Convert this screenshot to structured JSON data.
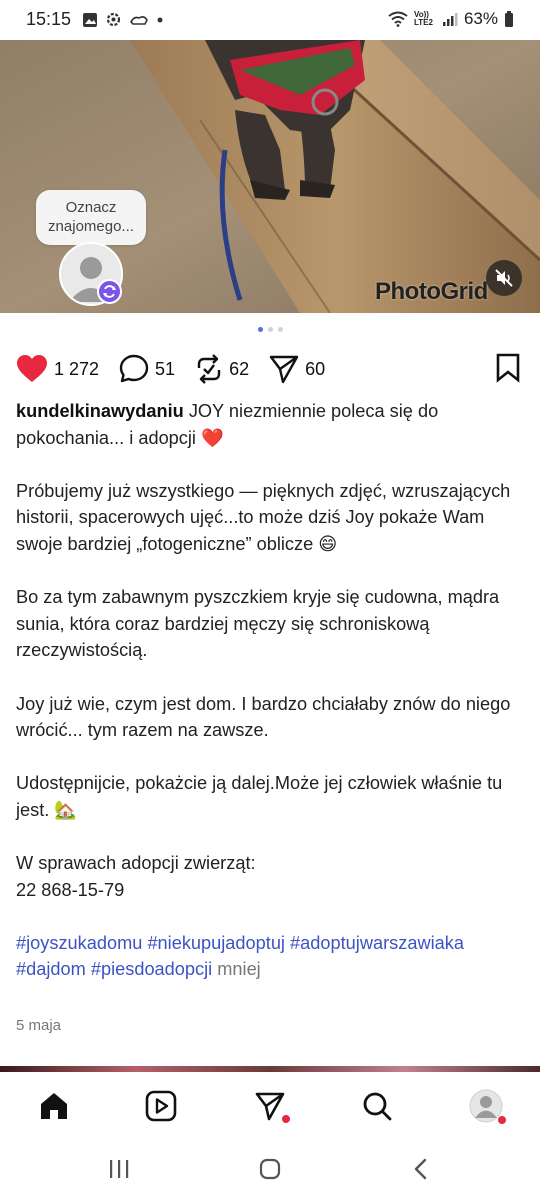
{
  "status_bar": {
    "time": "15:15",
    "network_label": "Vo)) LTE2",
    "battery": "63%"
  },
  "post_image": {
    "tag_prompt": "Oznacz znajomego...",
    "watermark": "PhotoGrid",
    "carousel": {
      "current": 1,
      "total": 3
    }
  },
  "actions": {
    "likes": "1 272",
    "comments": "51",
    "reposts": "62",
    "shares": "60"
  },
  "caption": {
    "username": "kundelkinawydaniu",
    "line1": " JOY niezmiennie poleca się do pokochania... i adopcji ❤️",
    "p2": "Próbujemy już wszystkiego — pięknych zdjęć, wzruszających historii, spacerowych ujęć...to może dziś Joy pokaże Wam swoje bardziej „fotogeniczne” oblicze 😄",
    "p3": "Bo za tym zabawnym pyszczkiem kryje się cudowna, mądra sunia, która coraz bardziej męczy się schroniskową rzeczywistością.",
    "p4": "Joy już wie, czym jest dom. I bardzo chciałaby znów do niego wrócić... tym razem na zawsze.",
    "p5": "Udostępnijcie, pokażcie ją dalej.Może jej człowiek właśnie tu jest. 🏡",
    "p6_line1": "W sprawach adopcji zwierząt:",
    "p6_line2": "22 868-15-79",
    "hashtags": [
      "#joyszukadomu",
      "#niekupujadoptuj",
      "#adoptujwarszawiaka",
      "#dajdom",
      "#piesdoadopcji"
    ],
    "more": "mniej"
  },
  "post_date": "5 maja",
  "colors": {
    "like": "#e8283f",
    "hashtag": "#3d53c4",
    "carousel_active": "#5b6ee8",
    "tag_badge": "#7a55e8"
  },
  "bottom_nav": {
    "items": [
      {
        "icon": "home-icon"
      },
      {
        "icon": "reels-icon"
      },
      {
        "icon": "direct-icon"
      },
      {
        "icon": "search-icon"
      },
      {
        "icon": "profile-icon"
      }
    ]
  },
  "android_nav": {
    "items": [
      "recents-icon",
      "home-circle-icon",
      "back-icon"
    ]
  }
}
